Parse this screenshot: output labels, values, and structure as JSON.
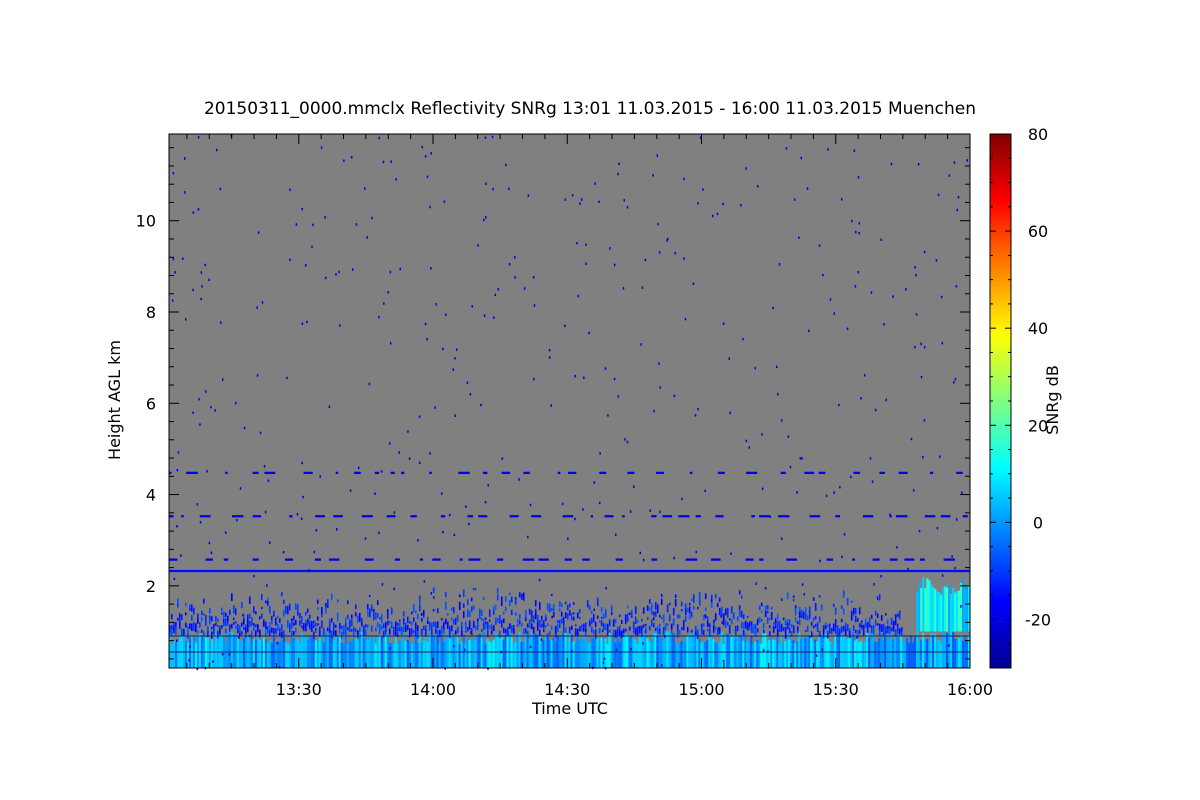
{
  "chart_data": {
    "type": "heatmap",
    "title": "20150311_0000.mmclx Reflectivity SNRg   13:01 11.03.2015 - 16:00 11.03.2015 Muenchen",
    "xlabel": "Time UTC",
    "ylabel": "Height AGL km",
    "colorbar_label": "SNRg dB",
    "xlim": [
      "13:01",
      "16:00"
    ],
    "ylim": [
      0.2,
      11.9
    ],
    "clim": [
      -30,
      80
    ],
    "x_ticks": [
      "13:30",
      "14:00",
      "14:30",
      "15:00",
      "15:30",
      "16:00"
    ],
    "y_ticks": [
      2,
      4,
      6,
      8,
      10
    ],
    "colorbar_ticks": [
      -20,
      0,
      20,
      40,
      60,
      80
    ],
    "background_color": "#808080",
    "colormap": [
      "#00008f",
      "#0000ff",
      "#0080ff",
      "#00ffff",
      "#80ff80",
      "#ffff00",
      "#ff8000",
      "#ff0000",
      "#800000"
    ],
    "layers": [
      {
        "time_start": "13:01",
        "time_end": "16:00",
        "height_bottom_km": 0.2,
        "height_top_km": 1.0,
        "snr_db": 2,
        "coverage": "dense"
      },
      {
        "time_start": "13:01",
        "time_end": "15:45",
        "height_bottom_km": 1.0,
        "height_top_km": 2.0,
        "snr_db": -12,
        "coverage": "broken"
      },
      {
        "time_start": "15:48",
        "time_end": "16:00",
        "height_bottom_km": 1.0,
        "height_top_km": 2.2,
        "snr_db": 10,
        "coverage": "dense"
      },
      {
        "time_start": "13:01",
        "time_end": "16:00",
        "height_bottom_km": 2.3,
        "height_top_km": 2.35,
        "snr_db": -15,
        "coverage": "line"
      },
      {
        "time_start": "13:01",
        "time_end": "16:00",
        "height_bottom_km": 2.55,
        "height_top_km": 2.6,
        "snr_db": -18,
        "coverage": "dashed"
      },
      {
        "time_start": "13:01",
        "time_end": "16:00",
        "height_bottom_km": 3.5,
        "height_top_km": 3.55,
        "snr_db": -18,
        "coverage": "dashed"
      },
      {
        "time_start": "13:01",
        "time_end": "16:00",
        "height_bottom_km": 4.45,
        "height_top_km": 4.5,
        "snr_db": -18,
        "coverage": "dashed"
      },
      {
        "time_start": "13:01",
        "time_end": "16:00",
        "height_bottom_km": 0.2,
        "height_top_km": 11.9,
        "snr_db": -20,
        "coverage": "sparse"
      }
    ],
    "grid": false
  }
}
